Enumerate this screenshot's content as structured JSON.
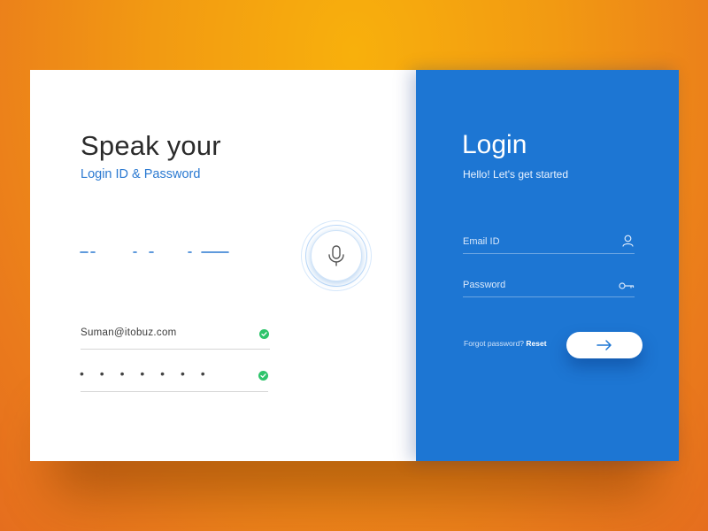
{
  "voice_panel": {
    "title": "Speak your",
    "subtitle": "Login ID & Password",
    "email_value": "Suman@itobuz.com",
    "password_masked": "• • • • • • •",
    "mic_icon": "microphone-icon",
    "check_icon": "check-circle-icon",
    "check_color": "#2ec46b",
    "accent": "#2a79d1"
  },
  "login_panel": {
    "title": "Login",
    "subtitle": "Hello! Let's get started",
    "email_placeholder": "Email ID",
    "password_placeholder": "Password",
    "email_icon": "user-icon",
    "password_icon": "key-icon",
    "forgot_text": "Forgot password?",
    "reset_text": "Reset",
    "submit_icon": "arrow-right-icon",
    "background": "#1d76d3"
  }
}
